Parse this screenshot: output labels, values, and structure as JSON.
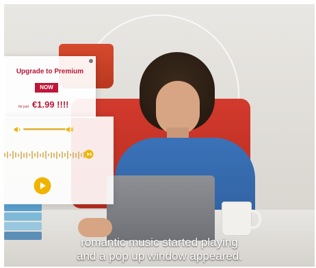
{
  "popup": {
    "title": "Upgrade to Premium",
    "cta_label": "NOW",
    "price_prefix": "for just",
    "price_value": "€1.99 !!!!"
  },
  "player": {
    "volume_icon_left": "speaker-low-icon",
    "volume_icon_right": "speaker-high-icon",
    "skip_icon": "skip-forward-icon",
    "play_icon": "play-icon",
    "accent_color": "#f0b400"
  },
  "caption": {
    "line1": "romantic music started playing",
    "line2": "and a pop up window appeared."
  },
  "colors": {
    "premium_red": "#b91737",
    "background": "#e7e4df",
    "shirt_blue": "#3a72b8",
    "chair_red": "#d23a2c"
  }
}
